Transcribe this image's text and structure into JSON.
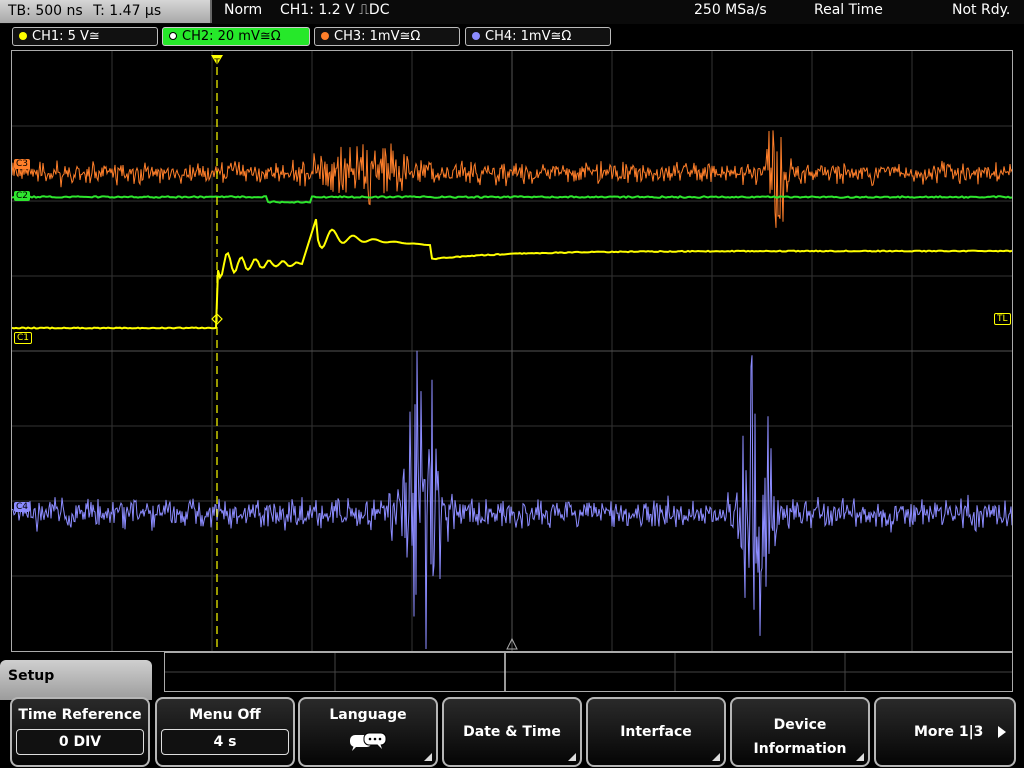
{
  "topbar": {
    "timebase": "TB: 500 ns",
    "trigger_time": "T: 1.47 µs",
    "mode": "Norm",
    "trigger_info": "CH1: 1.2 V ⎍DC",
    "sample_rate": "250 MSa/s",
    "acq_mode": "Real Time",
    "status": "Not Rdy."
  },
  "channels": [
    {
      "label": "CH1: 5 V≅",
      "color": "#ffff00",
      "active": false
    },
    {
      "label": "CH2: 20 mV≅Ω",
      "color": "#2ee62e",
      "active": true
    },
    {
      "label": "CH3: 1mV≅Ω",
      "color": "#ff7f2a",
      "active": false
    },
    {
      "label": "CH4: 1mV≅Ω",
      "color": "#8c8cff",
      "active": false
    }
  ],
  "markers": {
    "c3": "C3",
    "c2": "C2",
    "c1": "C1",
    "c4": "C4",
    "trigger_level": "TL",
    "trigger_pos": "T"
  },
  "colors": {
    "ch1": "#ffff00",
    "ch2": "#2ee62e",
    "ch3": "#ff7f2a",
    "ch4": "#8c8cff",
    "grid": "#3a3a3a"
  },
  "menu": {
    "title": "Setup",
    "softkeys": [
      {
        "label": "Time Reference",
        "value": "0 DIV"
      },
      {
        "label": "Menu Off",
        "value": "4 s"
      },
      {
        "label": "Language",
        "icon": "speech-bubble-icon"
      },
      {
        "label": "Date & Time"
      },
      {
        "label": "Interface"
      },
      {
        "label": "Device Information"
      },
      {
        "label": "More 1|3"
      }
    ]
  }
}
